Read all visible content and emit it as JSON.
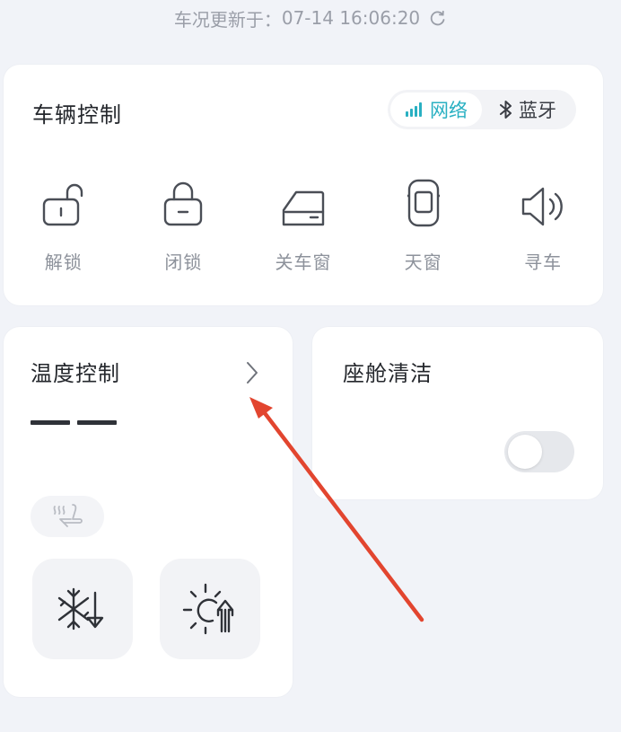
{
  "status": {
    "update_label": "车况更新于：",
    "update_time": "07-14 16:06:20"
  },
  "vehicle_control": {
    "title": "车辆控制",
    "connection": {
      "network_label": "网络",
      "bluetooth_label": "蓝牙",
      "active": "network"
    },
    "controls": [
      {
        "label": "解锁",
        "icon": "unlock-icon"
      },
      {
        "label": "闭锁",
        "icon": "lock-icon"
      },
      {
        "label": "关车窗",
        "icon": "car-window-icon"
      },
      {
        "label": "天窗",
        "icon": "sunroof-icon"
      },
      {
        "label": "寻车",
        "icon": "speaker-icon"
      }
    ]
  },
  "temperature_control": {
    "title": "温度控制",
    "value": "——",
    "seat_heat_icon": "seat-heat-icon",
    "cool_icon": "snowflake-down-icon",
    "heat_icon": "sun-up-icon"
  },
  "cabin_clean": {
    "title": "座舱清洁",
    "enabled": false
  },
  "colors": {
    "accent": "#29b0c2",
    "annotation": "#e2452f"
  }
}
